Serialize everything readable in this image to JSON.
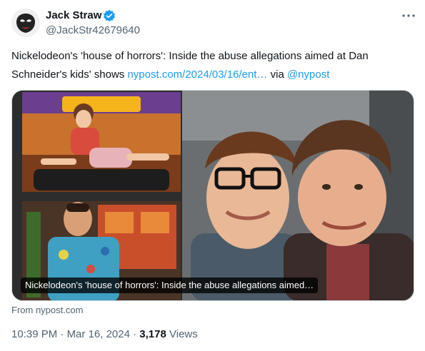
{
  "author": {
    "display_name": "Jack Straw",
    "handle": "@JackStr42679640",
    "avatar_icon": "mask-avatar-icon",
    "verified_icon": "verified-badge-icon",
    "verified_color": "#1d9bf0"
  },
  "more_icon": "more-options-icon",
  "tweet": {
    "text_before": "Nickelodeon's 'house of horrors': Inside the abuse allegations aimed at Dan Schneider's kids' shows ",
    "link_url": "nypost.com/2024/03/16/ent…",
    "text_via": " via ",
    "mention": "@nypost"
  },
  "card": {
    "overlay_title": "Nickelodeon's 'house of horrors': Inside the abuse allegations aimed…",
    "source": "From nypost.com"
  },
  "meta": {
    "time": "10:39 PM",
    "separator1": " · ",
    "date": "Mar 16, 2024",
    "separator2": " · ",
    "views_count": "3,178",
    "views_label": " Views"
  },
  "colors": {
    "link": "#1d9bf0",
    "secondary_text": "#536471",
    "primary_text": "#0f1419"
  }
}
